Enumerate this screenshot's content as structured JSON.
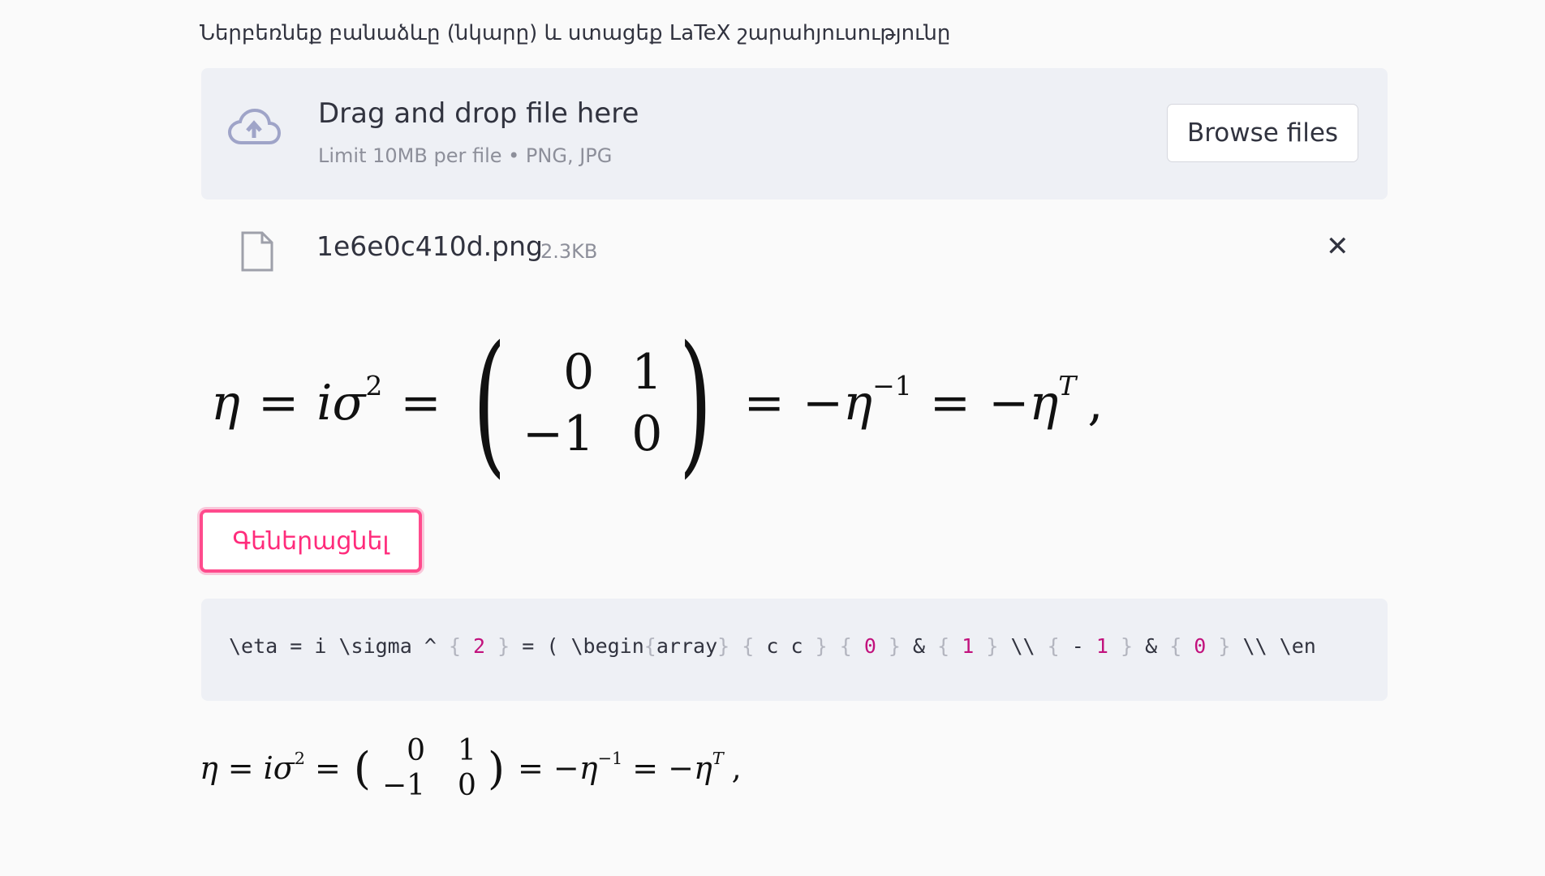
{
  "uploader": {
    "label": "Ներբեռնեք բանաձևը (նկարը) և ստացեք LaTeX շարահյուսությունը",
    "drop_title": "Drag and drop file here",
    "drop_subtitle": "Limit 10MB per file • PNG, JPG",
    "browse_label": "Browse files",
    "icon": "cloud-upload-icon"
  },
  "uploaded_file": {
    "name": "1e6e0c410d.png",
    "size": "2.3KB",
    "icon": "file-icon",
    "remove_icon": "close-icon",
    "remove_symbol": "✕"
  },
  "formula_image": {
    "lhs": "η",
    "i": "i",
    "sigma": "σ",
    "sigma_exp": "2",
    "eq": "=",
    "lparen": "(",
    "rparen": ")",
    "matrix": [
      "0",
      "1",
      "−1",
      "0"
    ],
    "minus_eta": "−η",
    "exp_inv": "−1",
    "exp_T": "T",
    "comma": ","
  },
  "generate_button": {
    "label": "Գեներացնել",
    "accent": "#ff4b8d"
  },
  "latex_code": {
    "prefix": "\\eta = i \\sigma ^ ",
    "lb1": "{",
    "two": " 2 ",
    "rb1": "}",
    "mid1": " = ( \\begin",
    "lb2": "{",
    "array": "array",
    "rb2": "}",
    "sp1": " ",
    "lb3": "{",
    "cc": " c c ",
    "rb3": "}",
    "sp2": " ",
    "lb4": "{",
    "zero1": " 0 ",
    "rb4": "}",
    "amp1": " & ",
    "lb5": "{",
    "one1": " 1 ",
    "rb5": "}",
    "nl1": " \\\\ ",
    "lb6": "{",
    "minus": " - ",
    "one2": "1 ",
    "rb6": "}",
    "amp2": " & ",
    "lb7": "{",
    "zero2": " 0 ",
    "rb7": "}",
    "nl2": " \\\\ \\en"
  }
}
